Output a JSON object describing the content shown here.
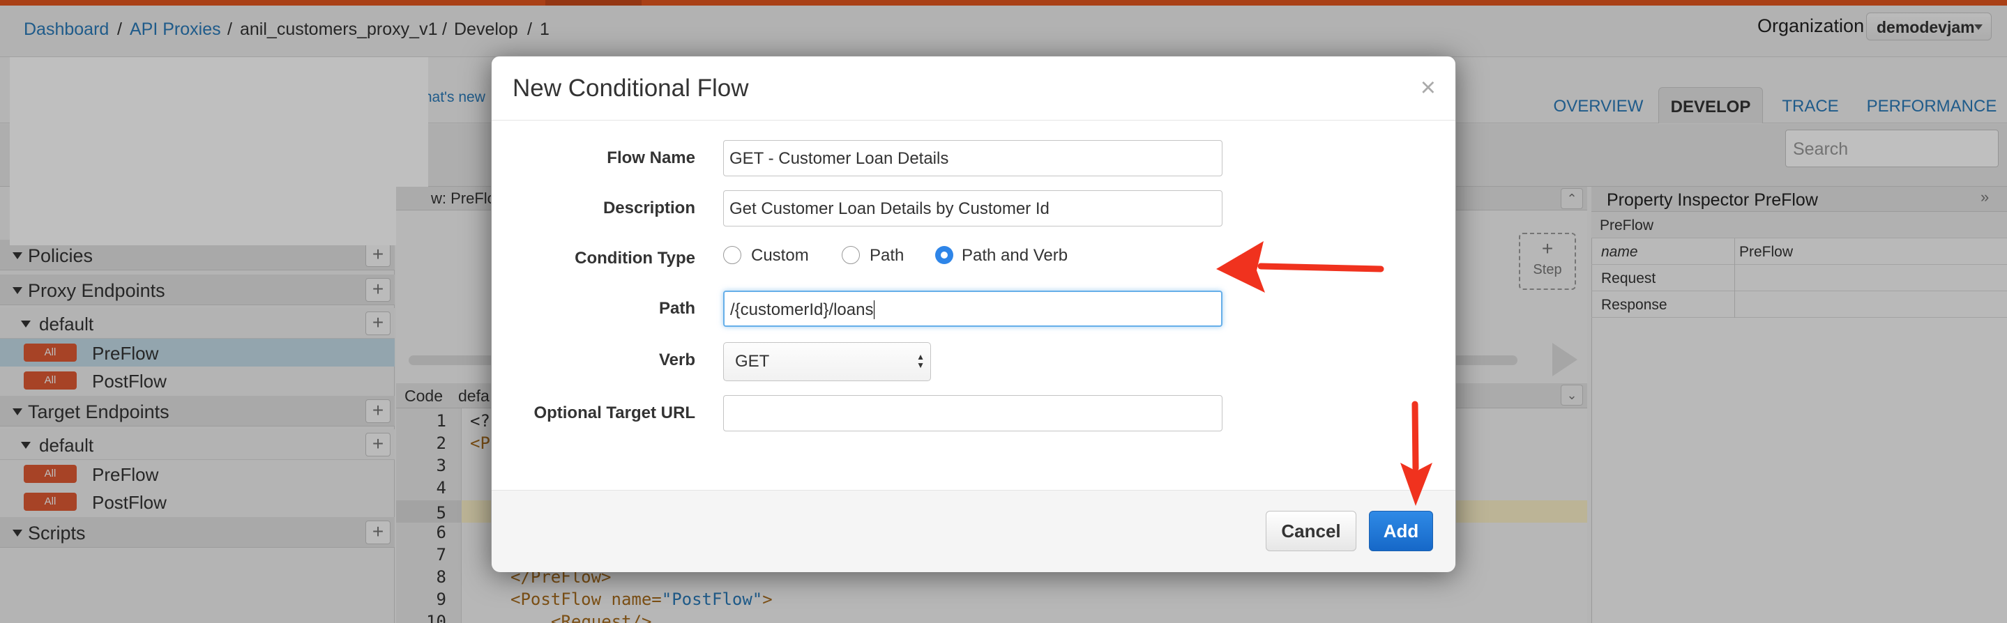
{
  "breadcrumb": {
    "dashboard": "Dashboard",
    "sep1": "/",
    "api_proxies": "API Proxies",
    "sep2": "/",
    "proxy": "anil_customers_proxy_v1",
    "sep3": "/",
    "develop": "Develop",
    "sep4": "/",
    "revision": "1"
  },
  "org": {
    "label": "Organization",
    "value": "demodevjam"
  },
  "whats_new": "/hat's new",
  "tabs": [
    {
      "label": "OVERVIEW",
      "active": false
    },
    {
      "label": "DEVELOP",
      "active": true
    },
    {
      "label": "TRACE",
      "active": false
    },
    {
      "label": "PERFORMANCE",
      "active": false
    }
  ],
  "search": {
    "placeholder": "Search"
  },
  "navigator": {
    "policies": "Policies",
    "proxy_endpoints": "Proxy Endpoints",
    "proxy_default": "default",
    "proxy_preflow": "PreFlow",
    "proxy_postflow": "PostFlow",
    "target_endpoints": "Target Endpoints",
    "target_default": "default",
    "target_preflow": "PreFlow",
    "target_postflow": "PostFlow",
    "scripts": "Scripts",
    "badge": "All",
    "plus": "+"
  },
  "flow": {
    "header": "w: PreFlo",
    "step_plus": "+",
    "step_label": "Step"
  },
  "code": {
    "header_code": "Code",
    "header_default": "defa",
    "line_numbers": [
      "1",
      "2",
      "3",
      "4",
      "5",
      "6",
      "7",
      "8",
      "9",
      "10"
    ],
    "line1": "<?",
    "line2": "<P",
    "line8": "</PreFlow>",
    "line9_tag": "<PostFlow ",
    "line9_attr": "name=",
    "line9_val": "\"PostFlow\"",
    "line9_close": ">",
    "line10": "<Request/>"
  },
  "inspector": {
    "title": "Property Inspector  PreFlow",
    "section": "PreFlow",
    "rows": [
      {
        "key": "name",
        "value": "PreFlow"
      },
      {
        "key": "Request",
        "value": ""
      },
      {
        "key": "Response",
        "value": ""
      }
    ]
  },
  "modal": {
    "title": "New Conditional Flow",
    "close": "×",
    "flow_name_label": "Flow Name",
    "flow_name_value": "GET - Customer Loan Details",
    "description_label": "Description",
    "description_value": "Get Customer Loan Details by Customer Id",
    "condition_type_label": "Condition Type",
    "condition_options": [
      {
        "label": "Custom",
        "selected": false
      },
      {
        "label": "Path",
        "selected": false
      },
      {
        "label": "Path and Verb",
        "selected": true
      }
    ],
    "path_label": "Path",
    "path_value": "/{customerId}/loans",
    "verb_label": "Verb",
    "verb_value": "GET",
    "target_url_label": "Optional Target URL",
    "target_url_value": "",
    "cancel_label": "Cancel",
    "add_label": "Add"
  },
  "colors": {
    "accent": "#e2561e",
    "link": "#2a7ab8",
    "primary_button": "#1668c8",
    "radio_selected": "#2e85e8",
    "annotation_arrow": "#f0321e",
    "badge": "#df5a33"
  }
}
